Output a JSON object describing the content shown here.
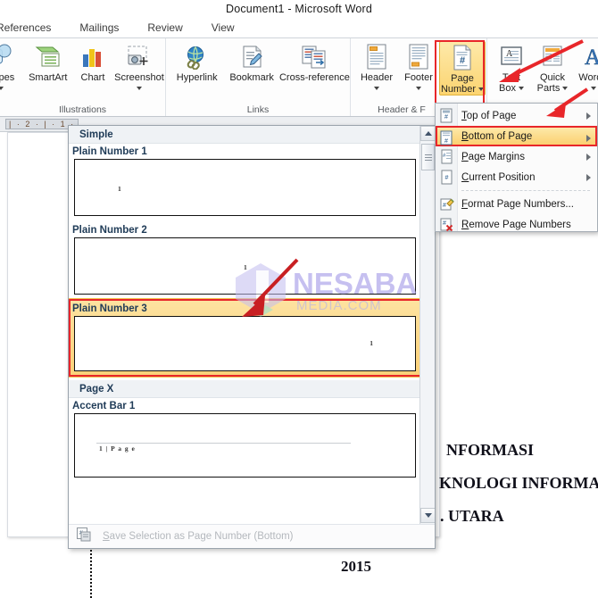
{
  "window": {
    "title": "Document1  -  Microsoft Word"
  },
  "tabs": [
    {
      "label": "References"
    },
    {
      "label": "Mailings"
    },
    {
      "label": "Review"
    },
    {
      "label": "View"
    }
  ],
  "ribbon": {
    "groups": [
      {
        "name": "Illustrations",
        "label": "Illustrations",
        "items": [
          {
            "id": "shapes",
            "label": "hapes",
            "icon": "shapes-icon",
            "dropdown": true
          },
          {
            "id": "smartart",
            "label": "SmartArt",
            "icon": "smartart-icon",
            "dropdown": false
          },
          {
            "id": "chart",
            "label": "Chart",
            "icon": "chart-icon",
            "dropdown": false
          },
          {
            "id": "screenshot",
            "label": "Screenshot",
            "icon": "screenshot-icon",
            "dropdown": true
          }
        ]
      },
      {
        "name": "Links",
        "label": "Links",
        "items": [
          {
            "id": "hyperlink",
            "label": "Hyperlink",
            "icon": "globe-link-icon",
            "dropdown": false
          },
          {
            "id": "bookmark",
            "label": "Bookmark",
            "icon": "bookmark-icon",
            "dropdown": false
          },
          {
            "id": "crossref",
            "label": "Cross-reference",
            "icon": "cross-reference-icon",
            "dropdown": false
          }
        ]
      },
      {
        "name": "Header & Footer",
        "label": "Header & F",
        "items": [
          {
            "id": "header",
            "label": "Header",
            "icon": "header-icon",
            "dropdown": true
          },
          {
            "id": "footer",
            "label": "Footer",
            "icon": "footer-icon",
            "dropdown": true
          },
          {
            "id": "pagenumber",
            "label_line1": "Page",
            "label_line2": "Number",
            "icon": "page-number-icon",
            "dropdown": true,
            "active": true
          }
        ]
      },
      {
        "name": "Text",
        "label": "",
        "items": [
          {
            "id": "textbox",
            "label_line1": "Text",
            "label_line2": "Box",
            "icon": "text-box-icon",
            "dropdown": true
          },
          {
            "id": "quickparts",
            "label_line1": "Quick",
            "label_line2": "Parts",
            "icon": "quick-parts-icon",
            "dropdown": true
          },
          {
            "id": "wordart",
            "label": "WordA",
            "icon": "wordart-icon",
            "dropdown": true
          }
        ]
      }
    ]
  },
  "menu": {
    "items": [
      {
        "label_pre": "",
        "label_u": "T",
        "label_post": "op of Page",
        "icon": "page-number-top-icon",
        "submenu": true,
        "highlighted": false
      },
      {
        "label_pre": "",
        "label_u": "B",
        "label_post": "ottom of Page",
        "icon": "page-number-bottom-icon",
        "submenu": true,
        "highlighted": true
      },
      {
        "label_pre": "",
        "label_u": "P",
        "label_post": "age Margins",
        "icon": "page-number-margins-icon",
        "submenu": true,
        "highlighted": false
      },
      {
        "label_pre": "",
        "label_u": "C",
        "label_post": "urrent Position",
        "icon": "page-number-current-icon",
        "submenu": true,
        "highlighted": false
      },
      {
        "separator": true
      },
      {
        "label_pre": "",
        "label_u": "F",
        "label_post": "ormat Page Numbers...",
        "icon": "format-page-numbers-icon",
        "submenu": false,
        "highlighted": false
      },
      {
        "label_pre": "",
        "label_u": "R",
        "label_post": "emove Page Numbers",
        "icon": "remove-page-numbers-icon",
        "submenu": false,
        "highlighted": false
      }
    ]
  },
  "gallery": {
    "category_simple": "Simple",
    "category_pagex": "Page X",
    "items": [
      {
        "title": "Plain Number 1",
        "align": "left",
        "sample": "1",
        "selected": false
      },
      {
        "title": "Plain Number 2",
        "align": "center",
        "sample": "1",
        "selected": false
      },
      {
        "title": "Plain Number 3",
        "align": "right",
        "sample": "1",
        "selected": true
      },
      {
        "title": "Accent Bar 1",
        "align": "left",
        "sample": "1 | P a g e",
        "selected": false
      }
    ],
    "save_selection_u": "S",
    "save_selection_rest": "ave Selection as Page Number (Bottom)"
  },
  "ruler": {
    "marks": "|  ·  2  ·  |  ·  1  ·"
  },
  "document": {
    "lines": [
      {
        "text": "NFORMASI"
      },
      {
        "text": "KNOLOGI INFORMAS"
      },
      {
        "text": ". UTARA"
      },
      {
        "text": "2015"
      }
    ]
  },
  "watermark": {
    "name": "NESABA",
    "sub": "MEDIA.COM"
  },
  "colors": {
    "accent_highlight": "#fbd071",
    "annotation_red": "#e8262a",
    "menu_border": "#a6aeb6",
    "title_text": "#1a1a1a"
  }
}
